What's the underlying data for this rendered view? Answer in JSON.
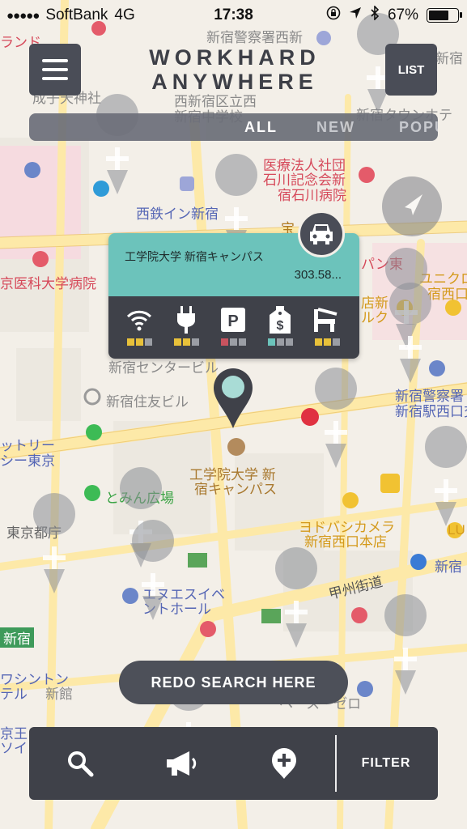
{
  "status_bar": {
    "signal": "●●●●●",
    "carrier": "SoftBank",
    "network": "4G",
    "time": "17:38",
    "battery": "67%"
  },
  "header": {
    "logo_line1": "WORKHARD",
    "logo_line2": "ANYWHERE",
    "list_label": "LIST"
  },
  "tabs": [
    {
      "label": "ALL",
      "active": true
    },
    {
      "label": "NEW",
      "active": false
    },
    {
      "label": "POPULA",
      "active": false
    }
  ],
  "callout": {
    "name": "工学院大学 新宿キャンパス",
    "distance": "303.58...",
    "amenities": [
      {
        "icon": "wifi-icon",
        "levels": [
          "#e8c13a",
          "#e8c13a",
          "#9b9ea5"
        ]
      },
      {
        "icon": "power-plug-icon",
        "levels": [
          "#e8c13a",
          "#e8c13a",
          "#9b9ea5"
        ]
      },
      {
        "icon": "parking-icon",
        "levels": [
          "#c9535f",
          "#9b9ea5",
          "#9b9ea5"
        ]
      },
      {
        "icon": "price-tag-icon",
        "levels": [
          "#6cc3bb",
          "#9b9ea5",
          "#9b9ea5"
        ]
      },
      {
        "icon": "seat-icon",
        "levels": [
          "#e8c13a",
          "#e8c13a",
          "#9b9ea5"
        ]
      }
    ]
  },
  "map": {
    "labels": [
      "新宿警察署西新",
      "西新宿区立西",
      "新宿中学校",
      "新宿タウンホテ",
      "成子天神社",
      "医療法人社団",
      "石川記念会新",
      "宿石川病院",
      "西鉄イン新宿",
      "宝",
      "京医科大学病院",
      "パン東",
      "ユニクロ",
      "宿西口",
      "店新",
      "ルク",
      "新宿センタービル",
      "新宿住友ビル",
      "新宿警察署",
      "新宿駅西口交",
      "ットリー",
      "シー東京",
      "とみん広場",
      "工学院大学 新",
      "宿キャンパス",
      "東京都庁",
      "ヨドバシカメラ",
      "新宿西口本店",
      "LU",
      "新宿",
      "甲州街道",
      "エヌエスイベ",
      "ントホール",
      "新宿",
      "ワシントン",
      "テル",
      "新館",
      "ヘース・ゼロ",
      "ランド",
      "新宿",
      "京王",
      "ソイ"
    ]
  },
  "redo_label": "REDO SEARCH HERE",
  "bottom_bar": {
    "filter_label": "FILTER"
  },
  "colors": {
    "dark_button": "#4a4d57",
    "teal": "#6cc3bb",
    "yellow": "#e8c13a",
    "red": "#c9535f",
    "map_background": "#f3efe8",
    "road": "#fde9a8"
  }
}
